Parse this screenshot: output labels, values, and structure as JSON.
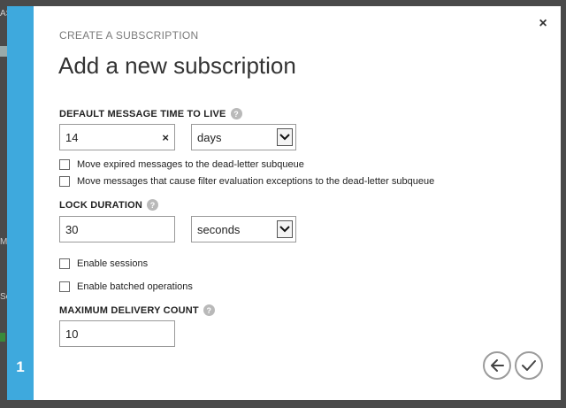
{
  "dialog": {
    "subtitle": "CREATE A SUBSCRIPTION",
    "title": "Add a new subscription",
    "step_number": "1",
    "close_glyph": "×"
  },
  "ttl": {
    "label": "DEFAULT MESSAGE TIME TO LIVE",
    "value": "14",
    "unit": "days",
    "clear_glyph": "×"
  },
  "checks": {
    "expired_label": "Move expired messages to the dead-letter subqueue",
    "filter_label": "Move messages that cause filter evaluation exceptions to the dead-letter subqueue",
    "sessions_label": "Enable sessions",
    "batched_label": "Enable batched operations"
  },
  "lock": {
    "label": "LOCK DURATION",
    "value": "30",
    "unit": "seconds"
  },
  "delivery": {
    "label": "MAXIMUM DELIVERY COUNT",
    "value": "10"
  },
  "help_glyph": "?",
  "nav": {
    "back_icon": "arrow-left-icon",
    "confirm_icon": "checkmark-icon"
  },
  "colors": {
    "rail": "#3ea9dd",
    "overlay": "#4a4a4a"
  }
}
